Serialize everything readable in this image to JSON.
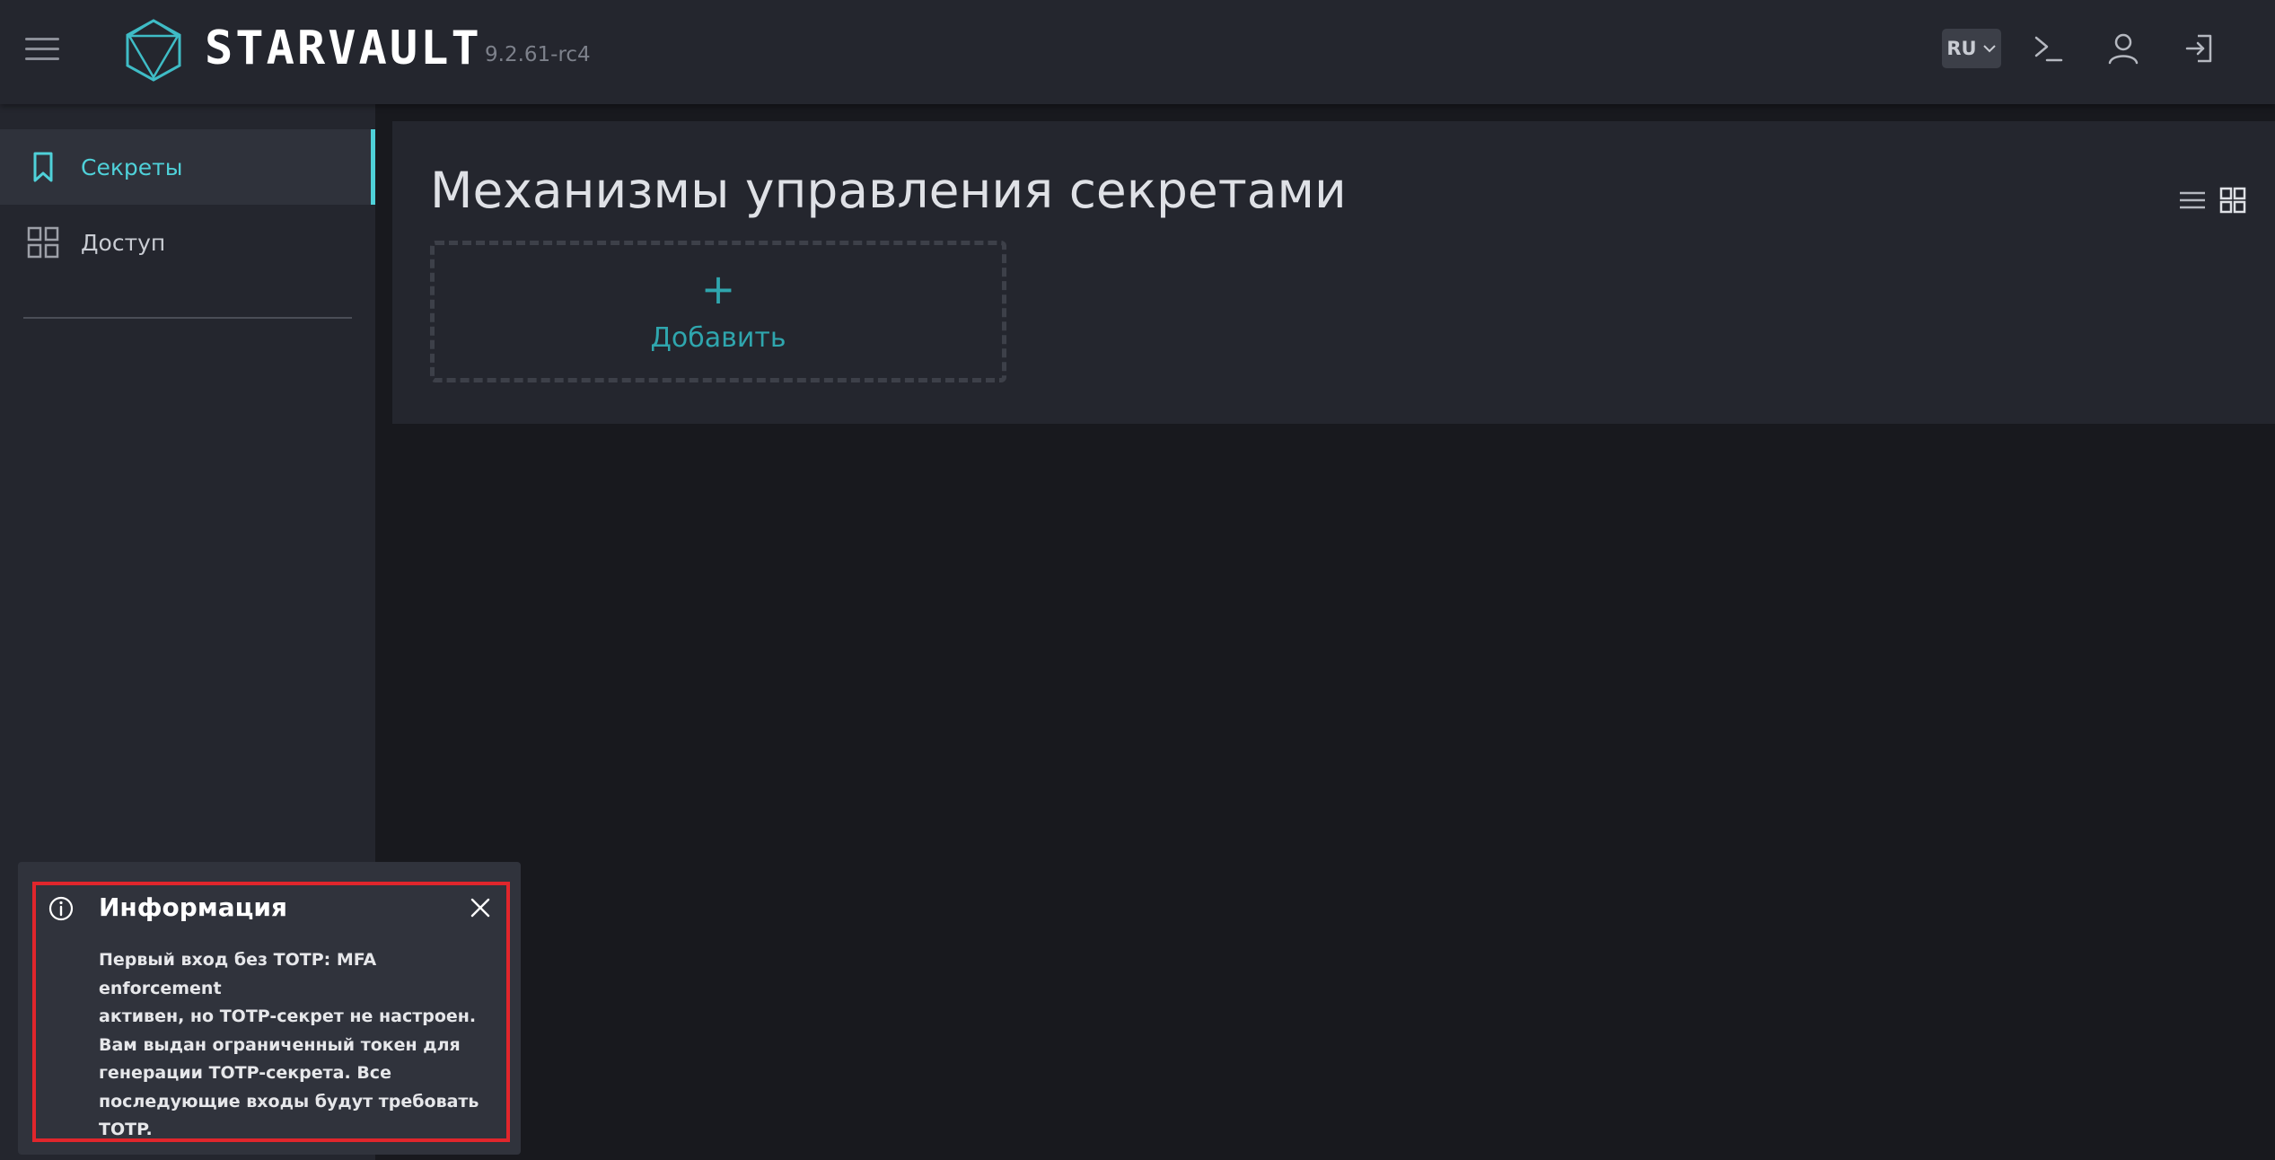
{
  "header": {
    "brand": "STARVAULT",
    "version": "9.2.61-rc4",
    "language": "RU"
  },
  "sidebar": {
    "items": [
      {
        "label": "Секреты",
        "icon": "bookmark-icon",
        "active": true
      },
      {
        "label": "Доступ",
        "icon": "grid-icon",
        "active": false
      }
    ]
  },
  "main": {
    "title": "Механизмы управления секретами",
    "add_label": "Добавить"
  },
  "toast": {
    "title": "Информация",
    "lines": [
      "Первый вход без TOTP: MFA enforcement",
      "активен, но TOTP-секрет не настроен.",
      "Вам выдан ограниченный токен для",
      "генерации TOTP-секрета. Все",
      "последующие входы будут требовать",
      "TOTP."
    ]
  },
  "colors": {
    "accent": "#4fd1d9",
    "add_accent": "#2fa6ae",
    "highlight": "#e0262c",
    "header_bg": "#24262e",
    "page_bg": "#18191e"
  }
}
